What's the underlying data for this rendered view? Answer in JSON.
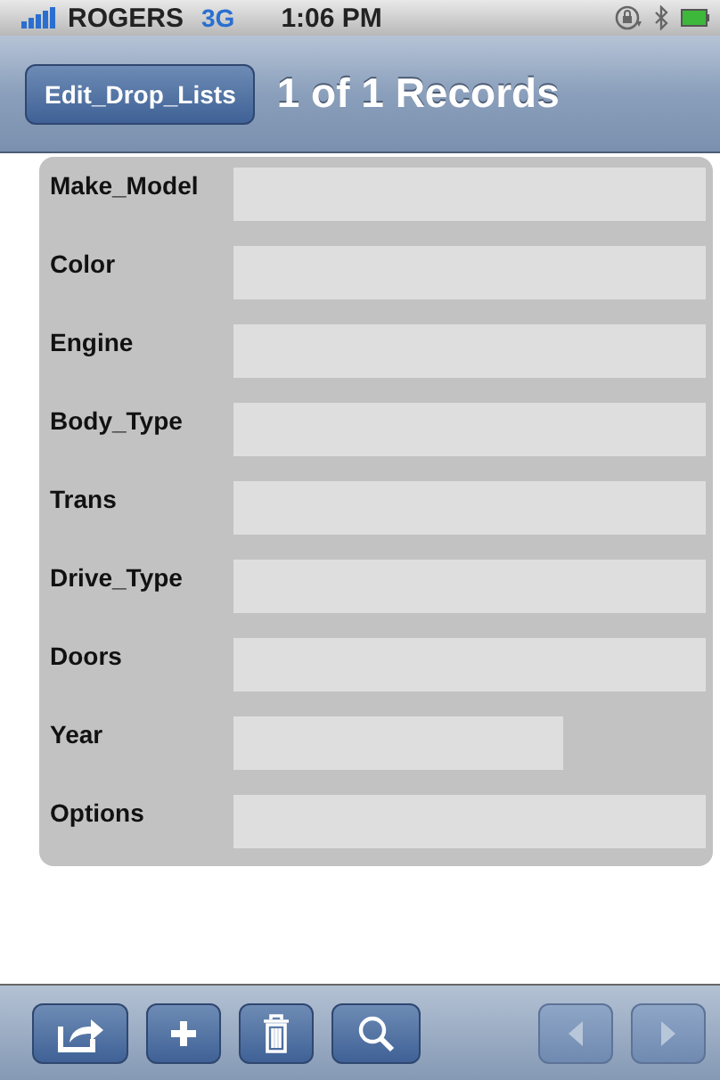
{
  "status_bar": {
    "carrier": "ROGERS",
    "network": "3G",
    "time": "1:06 PM"
  },
  "nav_bar": {
    "button": "Edit_Drop_Lists",
    "title": "1 of 1 Records"
  },
  "fields": [
    {
      "label": "Make_Model",
      "kind": "full"
    },
    {
      "label": "Color",
      "kind": "full"
    },
    {
      "label": "Engine",
      "kind": "full"
    },
    {
      "label": "Body_Type",
      "kind": "full"
    },
    {
      "label": "Trans",
      "kind": "full"
    },
    {
      "label": "Drive_Type",
      "kind": "full"
    },
    {
      "label": "Doors",
      "kind": "full"
    },
    {
      "label": "Year",
      "kind": "short"
    },
    {
      "label": "Options",
      "kind": "full"
    }
  ],
  "toolbar": [
    {
      "kind": "share",
      "disabled": false
    },
    {
      "kind": "add",
      "disabled": false
    },
    {
      "kind": "trash",
      "disabled": false
    },
    {
      "kind": "search",
      "disabled": false
    },
    {
      "kind": "spacer"
    },
    {
      "kind": "previous",
      "disabled": true
    },
    {
      "kind": "next",
      "disabled": true
    }
  ]
}
